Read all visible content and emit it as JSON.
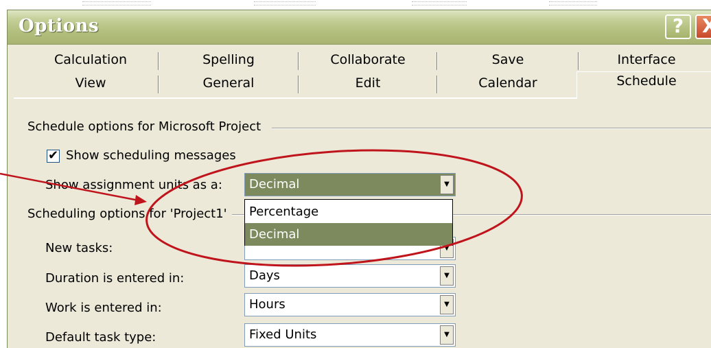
{
  "window": {
    "title": "Options",
    "help_label": "?",
    "close_label": "X"
  },
  "tabs_row1": [
    "Calculation",
    "Spelling",
    "Collaborate",
    "Save",
    "Interface"
  ],
  "tabs_row2": [
    "View",
    "General",
    "Edit",
    "Calendar",
    "Schedule"
  ],
  "active_tab": "Schedule",
  "group1": {
    "label": "Schedule options for Microsoft Project",
    "show_messages_label": "Show scheduling messages",
    "show_messages_checked": true,
    "check_mark": "✔",
    "assignment_units_label": "Show assignment units as a:",
    "assignment_units_value": "Decimal",
    "assignment_units_options": [
      "Percentage",
      "Decimal"
    ]
  },
  "group2": {
    "label": "Scheduling options for 'Project1'",
    "new_tasks_label": "New tasks:",
    "duration_label": "Duration is entered in:",
    "duration_value": "Days",
    "work_label": "Work is entered in:",
    "work_value": "Hours",
    "task_type_label": "Default task type:",
    "task_type_value": "Fixed Units"
  },
  "dropdown_arrow": "▼",
  "annotation_color": "#c0141c",
  "accent_color": "#7c8a5d"
}
